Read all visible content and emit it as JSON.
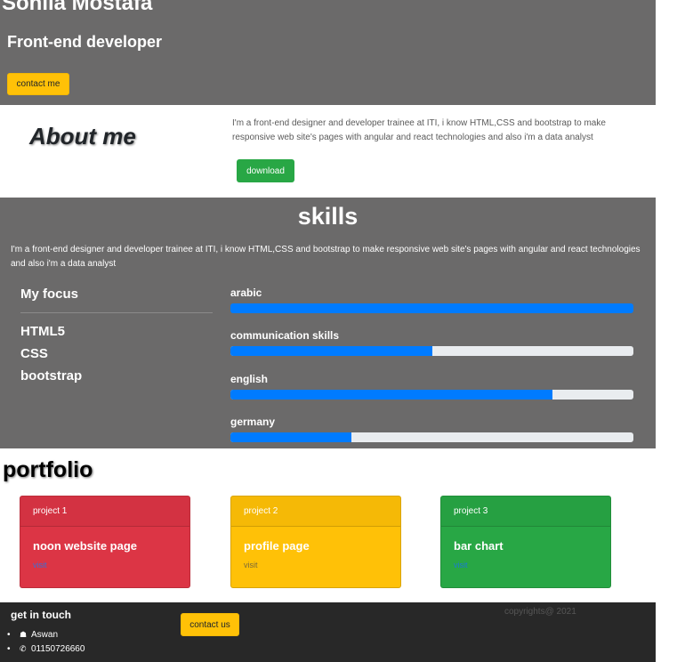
{
  "hero": {
    "name": "Sohila Mostafa",
    "role": "Front-end developer",
    "button_label": "contact me"
  },
  "about": {
    "title": "About me",
    "text": "I'm a front-end designer and developer trainee at ITI, i know HTML,CSS and bootstrap to make responsive web site's pages with angular and react technologies and also i'm a data analyst",
    "button_label": "download"
  },
  "skills": {
    "title": "skills",
    "text": "I'm a front-end designer and developer trainee at ITI, i know HTML,CSS and bootstrap to make responsive web site's pages with angular and react technologies and also i'm a data analyst",
    "focus_title": "My focus",
    "focus_items": [
      "HTML5",
      "CSS",
      "bootstrap"
    ],
    "bars": [
      {
        "label": "arabic",
        "percent": 100
      },
      {
        "label": "communication skills",
        "percent": 50
      },
      {
        "label": "english",
        "percent": 80
      },
      {
        "label": "germany",
        "percent": 30
      }
    ]
  },
  "portfolio": {
    "title": "portfolio",
    "cards": [
      {
        "header": "project 1",
        "title": "noon website page",
        "link": "visit"
      },
      {
        "header": "project 2",
        "title": "profile page",
        "link": "visit"
      },
      {
        "header": "project 3",
        "title": "bar chart",
        "link": "visit"
      }
    ]
  },
  "footer": {
    "title": "get in touch",
    "contacts": [
      {
        "icon": "home-icon",
        "glyph": "☗",
        "text": "Aswan"
      },
      {
        "icon": "phone-icon",
        "glyph": "✆",
        "text": "01150726660"
      }
    ],
    "button_label": "contact us",
    "copyright": "copyrights@ 2021"
  },
  "colors": {
    "section_gray": "#6b6a6a",
    "footer_dark": "#282828",
    "primary_blue": "#007bff",
    "warning_yellow": "#ffc107",
    "success_green": "#28a745",
    "danger_red": "#dc3545"
  }
}
